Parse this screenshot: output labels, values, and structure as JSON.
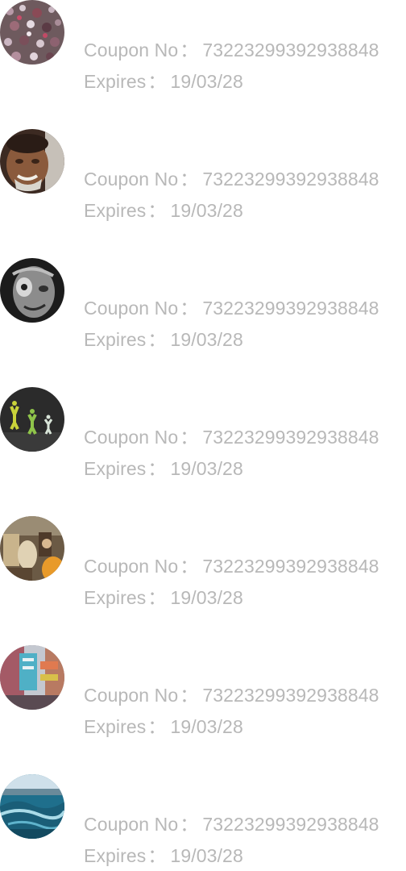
{
  "coupons": [
    {
      "avatar": "glitter-photo-avatar",
      "number_label": "Coupon No",
      "number": "73223299392938848",
      "expires_label": "Expires",
      "expires": "19/03/28"
    },
    {
      "avatar": "old-man-portrait-avatar",
      "number_label": "Coupon No",
      "number": "73223299392938848",
      "expires_label": "Expires",
      "expires": "19/03/28"
    },
    {
      "avatar": "bw-face-portrait-avatar",
      "number_label": "Coupon No",
      "number": "73223299392938848",
      "expires_label": "Expires",
      "expires": "19/03/28"
    },
    {
      "avatar": "jumping-figures-avatar",
      "number_label": "Coupon No",
      "number": "73223299392938848",
      "expires_label": "Expires",
      "expires": "19/03/28"
    },
    {
      "avatar": "street-market-avatar",
      "number_label": "Coupon No",
      "number": "73223299392938848",
      "expires_label": "Expires",
      "expires": "19/03/28"
    },
    {
      "avatar": "city-signs-avatar",
      "number_label": "Coupon No",
      "number": "73223299392938848",
      "expires_label": "Expires",
      "expires": "19/03/28"
    },
    {
      "avatar": "ocean-wave-avatar",
      "number_label": "Coupon No",
      "number": "73223299392938848",
      "expires_label": "Expires",
      "expires": "19/03/28"
    }
  ],
  "separator": "："
}
